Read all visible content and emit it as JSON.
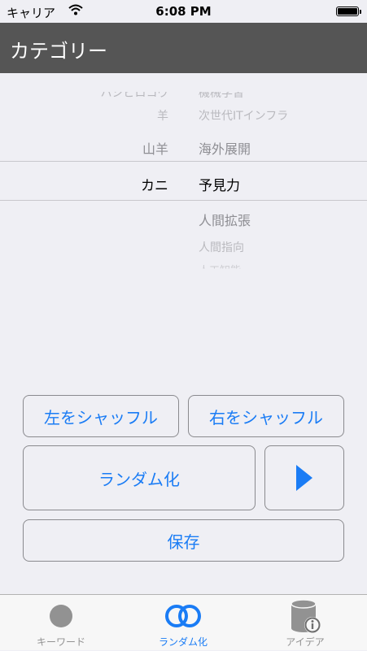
{
  "status_bar": {
    "carrier": "キャリア",
    "time": "6:08 PM",
    "battery_level": 1.0
  },
  "nav_bar": {
    "title": "カテゴリー"
  },
  "picker": {
    "left_column": [
      "ハシビロコウ",
      "羊",
      "山羊",
      "カニ"
    ],
    "left_selected": "カニ",
    "right_column": [
      "機械学習",
      "次世代ITインフラ",
      "海外展開",
      "予見力",
      "人間拡張",
      "人間指向",
      "人工知能"
    ],
    "right_selected": "予見力"
  },
  "buttons": {
    "shuffle_left": "左をシャッフル",
    "shuffle_right": "右をシャッフル",
    "randomize": "ランダム化",
    "play_icon": "play-icon",
    "save": "保存"
  },
  "tab_bar": {
    "tabs": [
      {
        "label": "キーワード",
        "icon": "circle-icon"
      },
      {
        "label": "ランダム化",
        "icon": "linked-rings-icon"
      },
      {
        "label": "アイデア",
        "icon": "database-info-icon"
      }
    ],
    "active": "ランダム化",
    "colors": {
      "active": "#1a7cf5",
      "inactive": "#929292"
    }
  }
}
